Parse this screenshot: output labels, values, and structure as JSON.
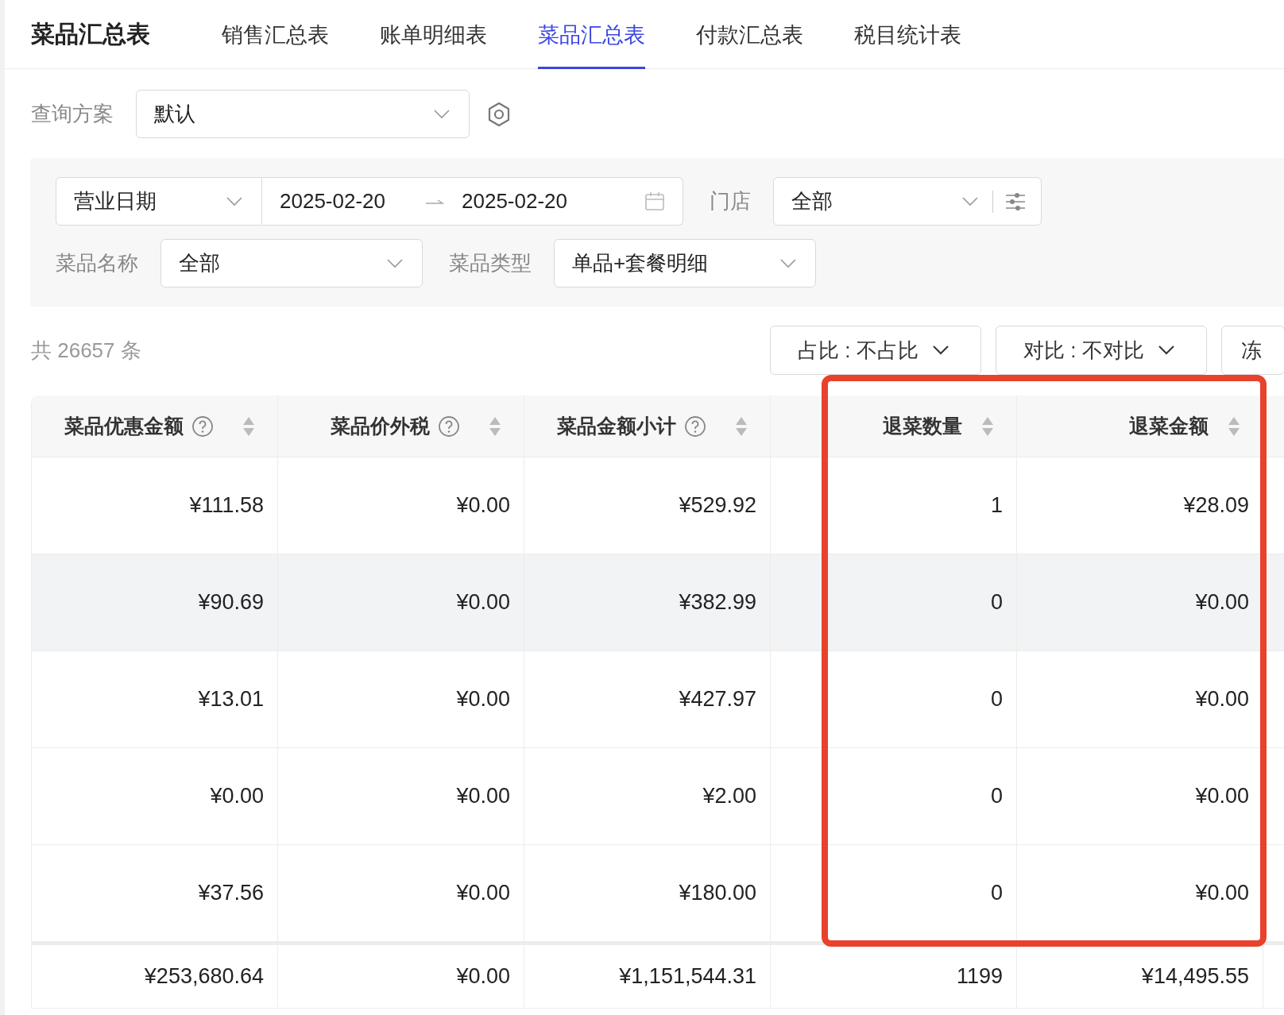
{
  "header": {
    "title": "菜品汇总表",
    "tabs": [
      {
        "label": "销售汇总表",
        "selected": false
      },
      {
        "label": "账单明细表",
        "selected": false
      },
      {
        "label": "菜品汇总表",
        "selected": true
      },
      {
        "label": "付款汇总表",
        "selected": false
      },
      {
        "label": "税目统计表",
        "selected": false
      }
    ]
  },
  "query_scheme": {
    "label": "查询方案",
    "value": "默认"
  },
  "filters": {
    "date_type": "营业日期",
    "date_start": "2025-02-20",
    "date_end": "2025-02-20",
    "store_label": "门店",
    "store_value": "全部",
    "dish_name_label": "菜品名称",
    "dish_name_value": "全部",
    "dish_type_label": "菜品类型",
    "dish_type_value": "单品+套餐明细"
  },
  "record_count": "共 26657 条",
  "toolbar_buttons": [
    {
      "label": "占比 : 不占比",
      "kind": "dropdown"
    },
    {
      "label": "对比 : 不对比",
      "kind": "dropdown"
    },
    {
      "label": "冻",
      "kind": "plain"
    }
  ],
  "table": {
    "columns": [
      {
        "title": "菜品优惠金额",
        "help": true,
        "highlighted": false
      },
      {
        "title": "菜品价外税",
        "help": true,
        "highlighted": false
      },
      {
        "title": "菜品金额小计",
        "help": true,
        "highlighted": false
      },
      {
        "title": "退菜数量",
        "help": false,
        "highlighted": true
      },
      {
        "title": "退菜金额",
        "help": false,
        "highlighted": true
      }
    ],
    "rows": [
      {
        "cells": [
          "¥111.58",
          "¥0.00",
          "¥529.92",
          "1",
          "¥28.09"
        ],
        "hovered": false
      },
      {
        "cells": [
          "¥90.69",
          "¥0.00",
          "¥382.99",
          "0",
          "¥0.00"
        ],
        "hovered": true
      },
      {
        "cells": [
          "¥13.01",
          "¥0.00",
          "¥427.97",
          "0",
          "¥0.00"
        ],
        "hovered": false
      },
      {
        "cells": [
          "¥0.00",
          "¥0.00",
          "¥2.00",
          "0",
          "¥0.00"
        ],
        "hovered": false
      },
      {
        "cells": [
          "¥37.56",
          "¥0.00",
          "¥180.00",
          "0",
          "¥0.00"
        ],
        "hovered": false
      }
    ],
    "totals": [
      "¥253,680.64",
      "¥0.00",
      "¥1,151,544.31",
      "1199",
      "¥14,495.55"
    ]
  }
}
